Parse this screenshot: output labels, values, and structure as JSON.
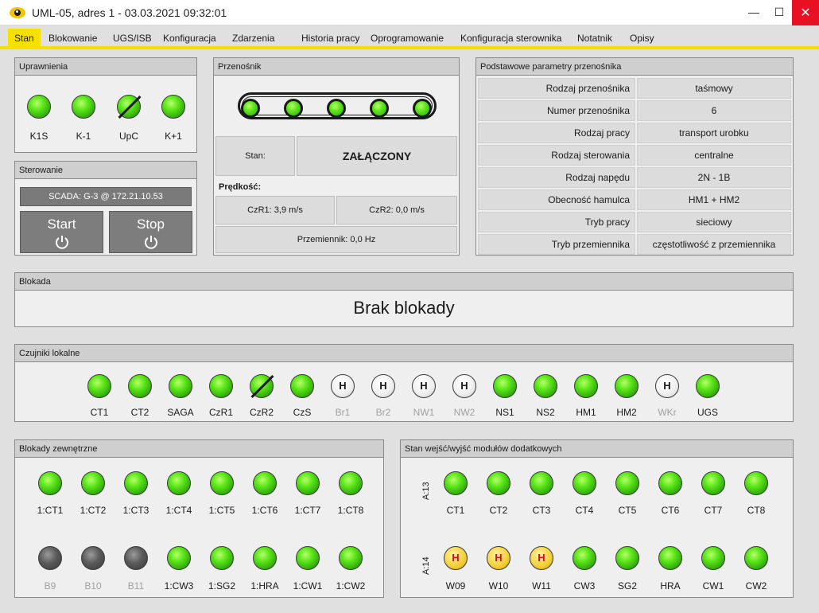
{
  "window": {
    "title": "UML-05, adres 1 - 03.03.2021 09:32:01",
    "minimize": "—",
    "maximize": "☐",
    "close": "✕"
  },
  "tabs": [
    {
      "label": "Stan",
      "active": true
    },
    {
      "label": "Blokowanie"
    },
    {
      "label": "UGS/ISB"
    },
    {
      "label": "Konfiguracja"
    },
    {
      "label": "Zdarzenia"
    },
    {
      "label": "Historia pracy"
    },
    {
      "label": "Oprogramowanie"
    },
    {
      "label": "Konfiguracja sterownika"
    },
    {
      "label": "Notatnik"
    },
    {
      "label": "Opisy"
    }
  ],
  "uprawnienia": {
    "title": "Uprawnienia",
    "leds": [
      {
        "label": "K1S",
        "state": "green"
      },
      {
        "label": "K-1",
        "state": "green"
      },
      {
        "label": "UpC",
        "state": "green",
        "crossed": true
      },
      {
        "label": "K+1",
        "state": "green"
      }
    ]
  },
  "sterowanie": {
    "title": "Sterowanie",
    "scada": "SCADA: G-3 @ 172.21.10.53",
    "start": "Start",
    "stop": "Stop"
  },
  "przenosnik": {
    "title": "Przenośnik",
    "stan_label": "Stan:",
    "stan_value": "ZAŁĄCZONY",
    "predkosc_label": "Prędkość:",
    "czr1": "CzR1: 3,9 m/s",
    "czr2": "CzR2: 0,0 m/s",
    "przemiennik": "Przemiennik: 0,0 Hz"
  },
  "parametry": {
    "title": "Podstawowe parametry przenośnika",
    "rows": [
      {
        "key": "Rodzaj przenośnika",
        "value": "taśmowy"
      },
      {
        "key": "Numer przenośnika",
        "value": "6"
      },
      {
        "key": "Rodzaj pracy",
        "value": "transport urobku"
      },
      {
        "key": "Rodzaj sterowania",
        "value": "centralne"
      },
      {
        "key": "Rodzaj napędu",
        "value": "2N - 1B"
      },
      {
        "key": "Obecność hamulca",
        "value": "HM1 + HM2"
      },
      {
        "key": "Tryb pracy",
        "value": "sieciowy"
      },
      {
        "key": "Tryb przemiennika",
        "value": "częstotliwość z przemiennika"
      }
    ]
  },
  "blokada": {
    "title": "Blokada",
    "text": "Brak blokady"
  },
  "czujniki": {
    "title": "Czujniki lokalne",
    "leds": [
      {
        "label": "CT1",
        "state": "green"
      },
      {
        "label": "CT2",
        "state": "green"
      },
      {
        "label": "SAGA",
        "state": "green"
      },
      {
        "label": "CzR1",
        "state": "green"
      },
      {
        "label": "CzR2",
        "state": "green",
        "crossed": true
      },
      {
        "label": "CzS",
        "state": "green"
      },
      {
        "label": "Br1",
        "state": "white",
        "h": "H",
        "dim": true
      },
      {
        "label": "Br2",
        "state": "white",
        "h": "H",
        "dim": true
      },
      {
        "label": "NW1",
        "state": "white",
        "h": "H",
        "dim": true
      },
      {
        "label": "NW2",
        "state": "white",
        "h": "H",
        "dim": true
      },
      {
        "label": "NS1",
        "state": "green"
      },
      {
        "label": "NS2",
        "state": "green"
      },
      {
        "label": "HM1",
        "state": "green"
      },
      {
        "label": "HM2",
        "state": "green"
      },
      {
        "label": "WKr",
        "state": "white",
        "h": "H",
        "dim": true
      },
      {
        "label": "UGS",
        "state": "green"
      }
    ]
  },
  "blokady_zewn": {
    "title": "Blokady zewnętrzne",
    "row1": [
      {
        "label": "1:CT1",
        "state": "green"
      },
      {
        "label": "1:CT2",
        "state": "green"
      },
      {
        "label": "1:CT3",
        "state": "green"
      },
      {
        "label": "1:CT4",
        "state": "green"
      },
      {
        "label": "1:CT5",
        "state": "green"
      },
      {
        "label": "1:CT6",
        "state": "green"
      },
      {
        "label": "1:CT7",
        "state": "green"
      },
      {
        "label": "1:CT8",
        "state": "green"
      }
    ],
    "row2": [
      {
        "label": "B9",
        "state": "gray",
        "dim": true
      },
      {
        "label": "B10",
        "state": "gray",
        "dim": true
      },
      {
        "label": "B11",
        "state": "gray",
        "dim": true
      },
      {
        "label": "1:CW3",
        "state": "green"
      },
      {
        "label": "1:SG2",
        "state": "green"
      },
      {
        "label": "1:HRA",
        "state": "green"
      },
      {
        "label": "1:CW1",
        "state": "green"
      },
      {
        "label": "1:CW2",
        "state": "green"
      }
    ]
  },
  "moduly": {
    "title": "Stan wejść/wyjść modułów dodatkowych",
    "row1_label": "A:13",
    "row2_label": "A:14",
    "row1": [
      {
        "label": "CT1",
        "state": "green"
      },
      {
        "label": "CT2",
        "state": "green"
      },
      {
        "label": "CT3",
        "state": "green"
      },
      {
        "label": "CT4",
        "state": "green"
      },
      {
        "label": "CT5",
        "state": "green"
      },
      {
        "label": "CT6",
        "state": "green"
      },
      {
        "label": "CT7",
        "state": "green"
      },
      {
        "label": "CT8",
        "state": "green"
      }
    ],
    "row2": [
      {
        "label": "W09",
        "state": "yellow",
        "h": "H"
      },
      {
        "label": "W10",
        "state": "yellow",
        "h": "H"
      },
      {
        "label": "W11",
        "state": "yellow",
        "h": "H"
      },
      {
        "label": "CW3",
        "state": "green"
      },
      {
        "label": "SG2",
        "state": "green"
      },
      {
        "label": "HRA",
        "state": "green"
      },
      {
        "label": "CW1",
        "state": "green"
      },
      {
        "label": "CW2",
        "state": "green"
      }
    ]
  },
  "colors": {
    "accent": "#f5e000",
    "close": "#e81123",
    "panel_header": "#cfcfcf"
  }
}
